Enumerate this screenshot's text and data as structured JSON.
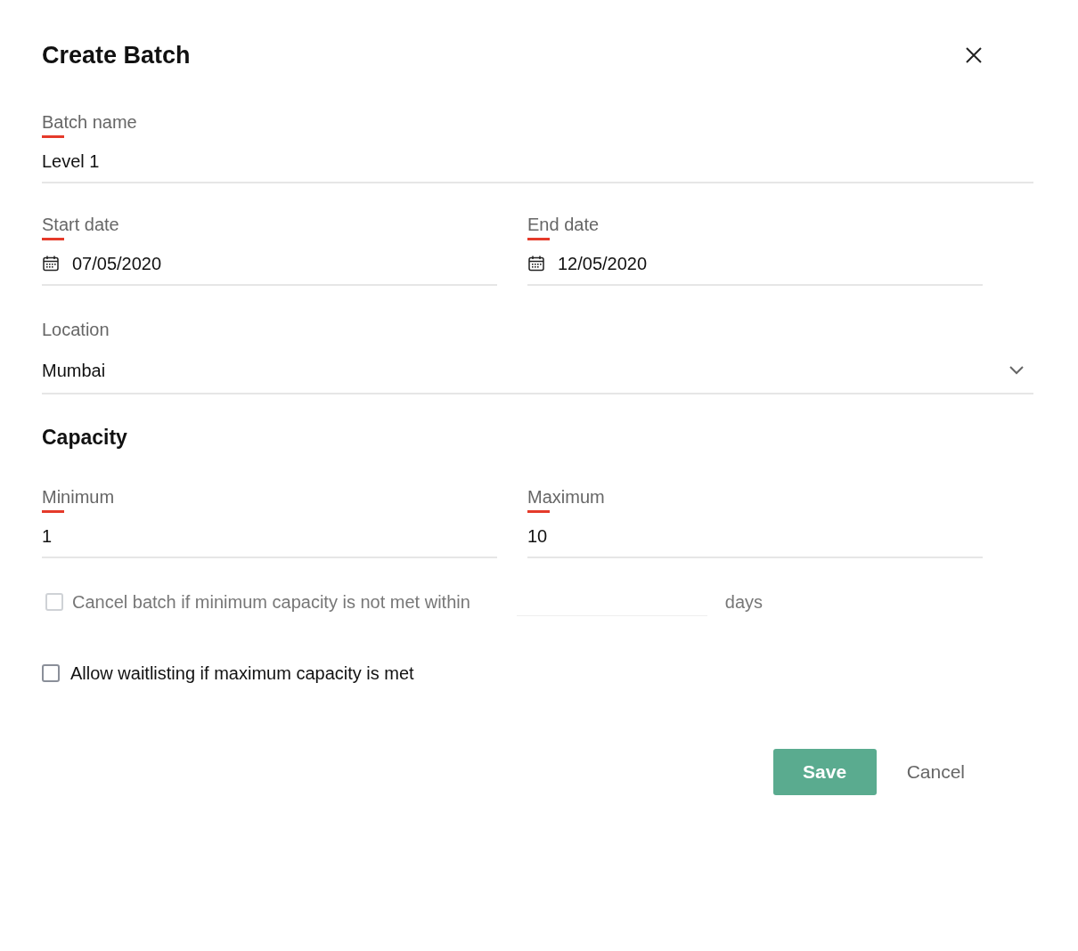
{
  "dialog": {
    "title": "Create Batch"
  },
  "batch_name": {
    "label": "Batch name",
    "required": true,
    "value": "Level 1"
  },
  "dates": [
    {
      "label": "Start date",
      "required": true,
      "kind": "date",
      "value": "07/05/2020"
    },
    {
      "label": "End date",
      "required": true,
      "kind": "date",
      "value": "12/05/2020"
    }
  ],
  "location": {
    "label": "Location",
    "required": false,
    "kind": "select",
    "value": "Mumbai"
  },
  "capacity": {
    "heading": "Capacity",
    "fields": [
      {
        "label": "Minimum",
        "required": true,
        "value": "1"
      },
      {
        "label": "Maximum",
        "required": true,
        "value": "10"
      }
    ]
  },
  "options": [
    {
      "kind": "days",
      "label": "Cancel batch if minimum capacity is not met within",
      "checked": false,
      "disabled": true,
      "suffix": "days"
    },
    {
      "kind": "plain",
      "label": "Allow waitlisting if maximum capacity is met",
      "checked": false,
      "disabled": false
    }
  ],
  "buttons": [
    {
      "kind": "primary",
      "label": "Save"
    },
    {
      "kind": "secondary",
      "label": "Cancel"
    }
  ]
}
